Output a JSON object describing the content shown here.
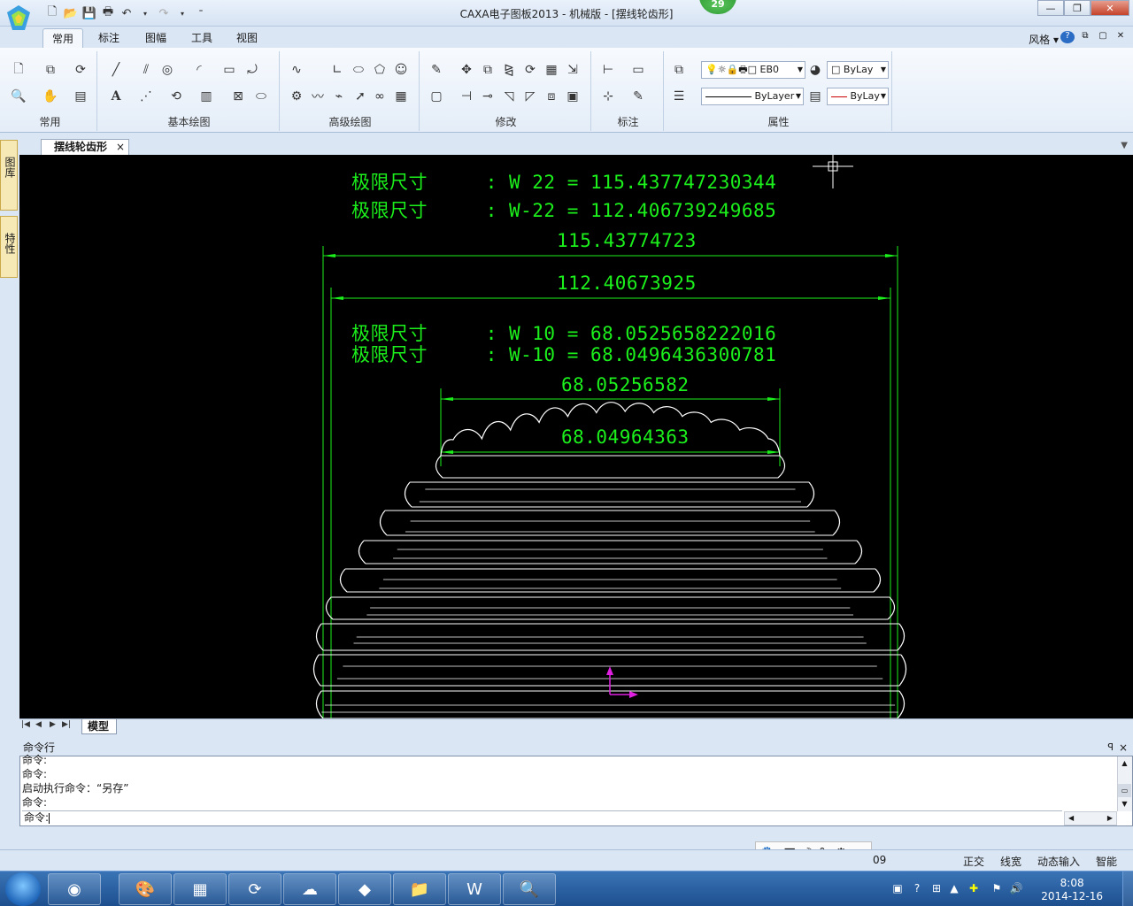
{
  "window": {
    "title": "CAXA电子图板2013 - 机械版 - [摆线轮齿形]",
    "badge": "29",
    "minimize": "—",
    "maximize": "❐",
    "close": "✕"
  },
  "ribbon": {
    "tabs": [
      "常用",
      "标注",
      "图幅",
      "工具",
      "视图"
    ],
    "active_tab": "常用",
    "style_label": "风格",
    "groups": [
      "常用",
      "基本绘图",
      "高级绘图",
      "修改",
      "标注",
      "属性"
    ],
    "layer_combo": "EB0",
    "color_combo": "ByLay",
    "linetype_combo": "ByLayer",
    "lineweight_combo": "ByLay"
  },
  "side_panels": [
    "图库",
    "特性"
  ],
  "document": {
    "tab_label": "摆线轮齿形",
    "close": "×"
  },
  "drawing": {
    "text_lines": [
      "极限尺寸     : W 22 = 115.437747230344",
      "极限尺寸     : W-22 = 112.406739249685",
      "极限尺寸     : W 10 = 68.0525658222016",
      "极限尺寸     : W-10 = 68.0496436300781"
    ],
    "dimensions": [
      "115.43774723",
      "112.40673925",
      "68.05256582",
      "68.04964363"
    ],
    "colors": {
      "background": "#000000",
      "dimension": "#1cf01c",
      "geometry": "#ffffff",
      "ucs": "#e020e0"
    }
  },
  "layout_tabs": {
    "nav": [
      "|◀",
      "◀",
      "▶",
      "▶|"
    ],
    "model": "模型"
  },
  "command": {
    "title": "命令行",
    "pin": "ꟼ",
    "close": "×",
    "history": [
      "命令:",
      "命令:",
      "启动执行命令：“另存”",
      "命令:"
    ],
    "prompt": "命令:"
  },
  "statusbar": {
    "coord_tail": "09",
    "items": [
      "正交",
      "线宽",
      "动态输入",
      "智能"
    ]
  },
  "ime": {
    "items": [
      "🐾",
      "五",
      "☽",
      "°,",
      "⚙"
    ]
  },
  "taskbar": {
    "time": "8:08",
    "date": "2014-12-16"
  }
}
